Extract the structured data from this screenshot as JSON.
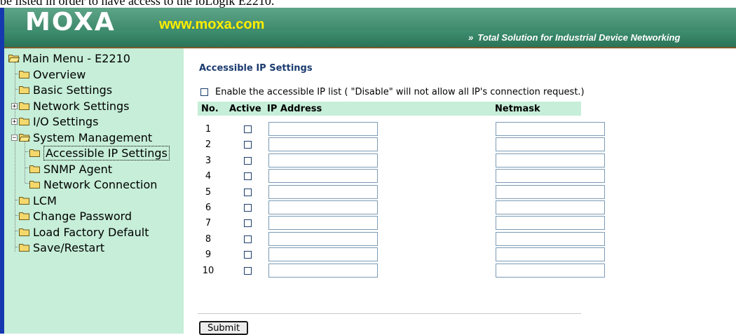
{
  "doc_fragment": "be listed in order to have access to the ioLogik E2210.",
  "header": {
    "logo": "MOXA",
    "url": "www.moxa.com",
    "tagline_chevron": "»",
    "tagline": "Total Solution for Industrial Device Networking"
  },
  "sidebar": {
    "root": "Main Menu - E2210",
    "items": [
      {
        "label": "Overview"
      },
      {
        "label": "Basic Settings"
      },
      {
        "label": "Network Settings"
      },
      {
        "label": "I/O Settings"
      },
      {
        "label": "System Management"
      },
      {
        "label": "Accessible IP Settings"
      },
      {
        "label": "SNMP Agent"
      },
      {
        "label": "Network Connection"
      },
      {
        "label": "LCM"
      },
      {
        "label": "Change Password"
      },
      {
        "label": "Load Factory Default"
      },
      {
        "label": "Save/Restart"
      }
    ]
  },
  "main": {
    "title": "Accessible IP Settings",
    "enable_label": "Enable the accessible IP list ( \"Disable\" will not allow all IP's connection request.)",
    "columns": {
      "no": "No.",
      "active": "Active",
      "ip": "IP Address",
      "netmask": "Netmask"
    },
    "rows": [
      {
        "no": "1",
        "active": false,
        "ip": "",
        "netmask": ""
      },
      {
        "no": "2",
        "active": false,
        "ip": "",
        "netmask": ""
      },
      {
        "no": "3",
        "active": false,
        "ip": "",
        "netmask": ""
      },
      {
        "no": "4",
        "active": false,
        "ip": "",
        "netmask": ""
      },
      {
        "no": "5",
        "active": false,
        "ip": "",
        "netmask": ""
      },
      {
        "no": "6",
        "active": false,
        "ip": "",
        "netmask": ""
      },
      {
        "no": "7",
        "active": false,
        "ip": "",
        "netmask": ""
      },
      {
        "no": "8",
        "active": false,
        "ip": "",
        "netmask": ""
      },
      {
        "no": "9",
        "active": false,
        "ip": "",
        "netmask": ""
      },
      {
        "no": "10",
        "active": false,
        "ip": "",
        "netmask": ""
      }
    ],
    "submit_label": "Submit"
  },
  "colors": {
    "header_green": "#3f8a6c",
    "sidebar_bg": "#c6eed8",
    "link_blue": "#1d2ec8",
    "url_yellow": "#ffee00"
  }
}
